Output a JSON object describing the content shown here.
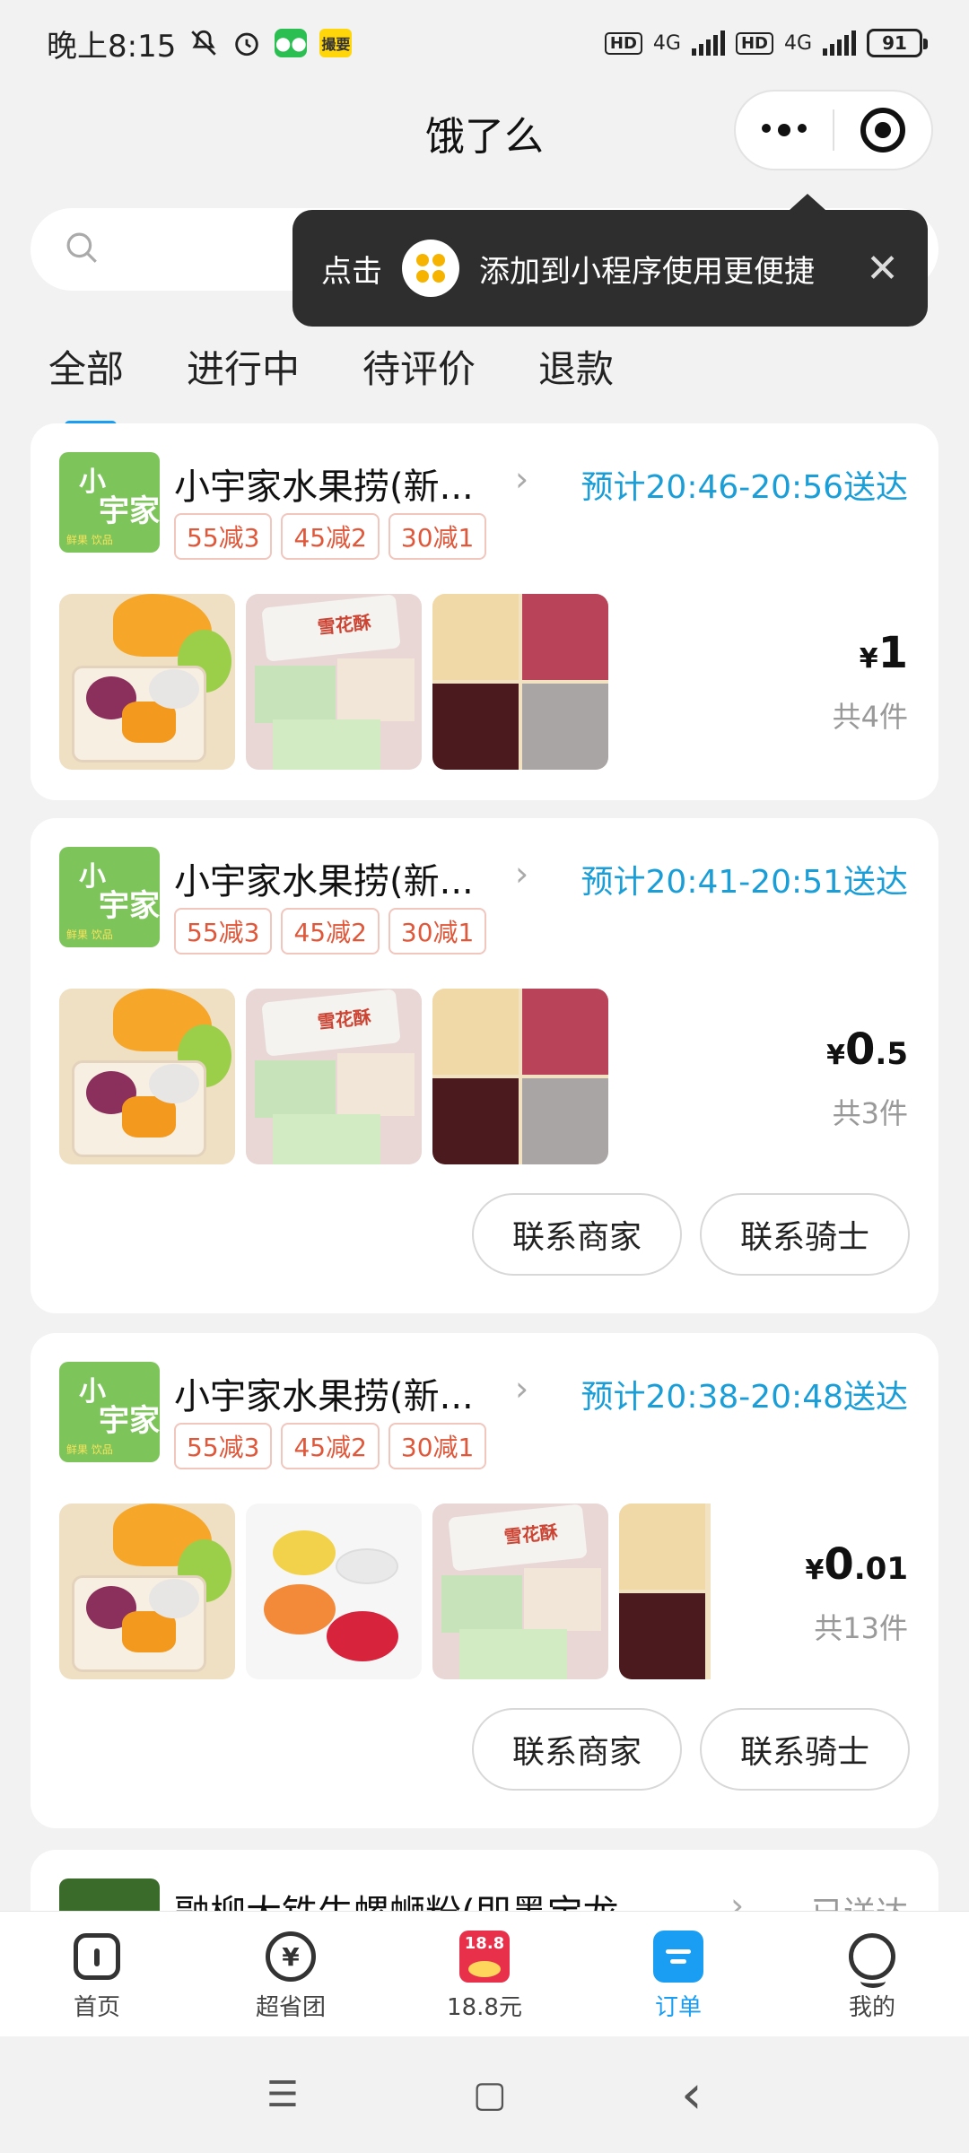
{
  "status_bar": {
    "time": "晚上8:15",
    "app_badge": "撮要",
    "hd1": "HD",
    "net1": "4G",
    "hd2": "HD",
    "net2": "4G",
    "battery": "91"
  },
  "header": {
    "title": "饿了么"
  },
  "tooltip": {
    "prefix": "点击",
    "text": "添加到小程序使用更便捷",
    "close": "✕"
  },
  "tabs": [
    "全部",
    "进行中",
    "待评价",
    "退款"
  ],
  "orders": [
    {
      "shop": "小宇家水果捞(新...",
      "eta": "预计20:46-20:56送达",
      "tags": [
        "55减3",
        "45减2",
        "30减1"
      ],
      "currency": "¥",
      "price_int": "1",
      "price_dec": "",
      "count": "共4件"
    },
    {
      "shop": "小宇家水果捞(新...",
      "eta": "预计20:41-20:51送达",
      "tags": [
        "55减3",
        "45减2",
        "30减1"
      ],
      "currency": "¥",
      "price_int": "0",
      "price_dec": ".5",
      "count": "共3件",
      "buttons": [
        "联系商家",
        "联系骑士"
      ]
    },
    {
      "shop": "小宇家水果捞(新...",
      "eta": "预计20:38-20:48送达",
      "tags": [
        "55减3",
        "45减2",
        "30减1"
      ],
      "currency": "¥",
      "price_int": "0",
      "price_dec": ".01",
      "count": "共13件",
      "buttons": [
        "联系商家",
        "联系骑士"
      ]
    },
    {
      "shop": "融柳大铁牛螺蛳粉(即墨宝龙",
      "status": "已送达"
    }
  ],
  "shop_logo": {
    "line1": "小",
    "line2": "宇家",
    "line3": "鲜果 饮品"
  },
  "snack_pkg_label": "雪花酥",
  "bottom_nav": [
    {
      "label": "首页",
      "icon": "home-icon"
    },
    {
      "label": "超省团",
      "icon": "savings-icon",
      "glyph": "¥"
    },
    {
      "label": "18.8元",
      "icon": "red-packet-icon",
      "glyph": "18.8"
    },
    {
      "label": "订单",
      "icon": "order-icon"
    },
    {
      "label": "我的",
      "icon": "profile-icon"
    }
  ],
  "system_nav": {
    "menu": "☰",
    "home": "▢",
    "back": "‹"
  }
}
